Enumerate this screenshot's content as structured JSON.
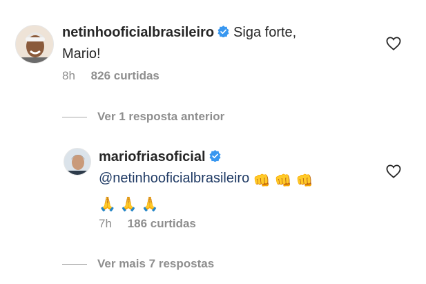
{
  "comments": [
    {
      "username": "netinhooficialbrasileiro",
      "text_line1": "Siga forte,",
      "text_line2": "Mario!",
      "time": "8h",
      "likes": "826 curtidas"
    }
  ],
  "view_previous": "Ver 1 resposta anterior",
  "reply": {
    "username": "mariofriasoficial",
    "mention": "@netinhooficialbrasileiro",
    "emojis_fists": [
      "👊",
      "👊",
      "👊"
    ],
    "emojis_pray": [
      "🙏",
      "🙏",
      "🙏"
    ],
    "time": "7h",
    "likes": "186 curtidas"
  },
  "view_more": "Ver mais 7 respostas",
  "colors": {
    "verified": "#3897f0",
    "muted": "#8e8e8e",
    "mention": "#1f3a64"
  },
  "icons": [
    "verified-badge-icon",
    "heart-icon"
  ]
}
